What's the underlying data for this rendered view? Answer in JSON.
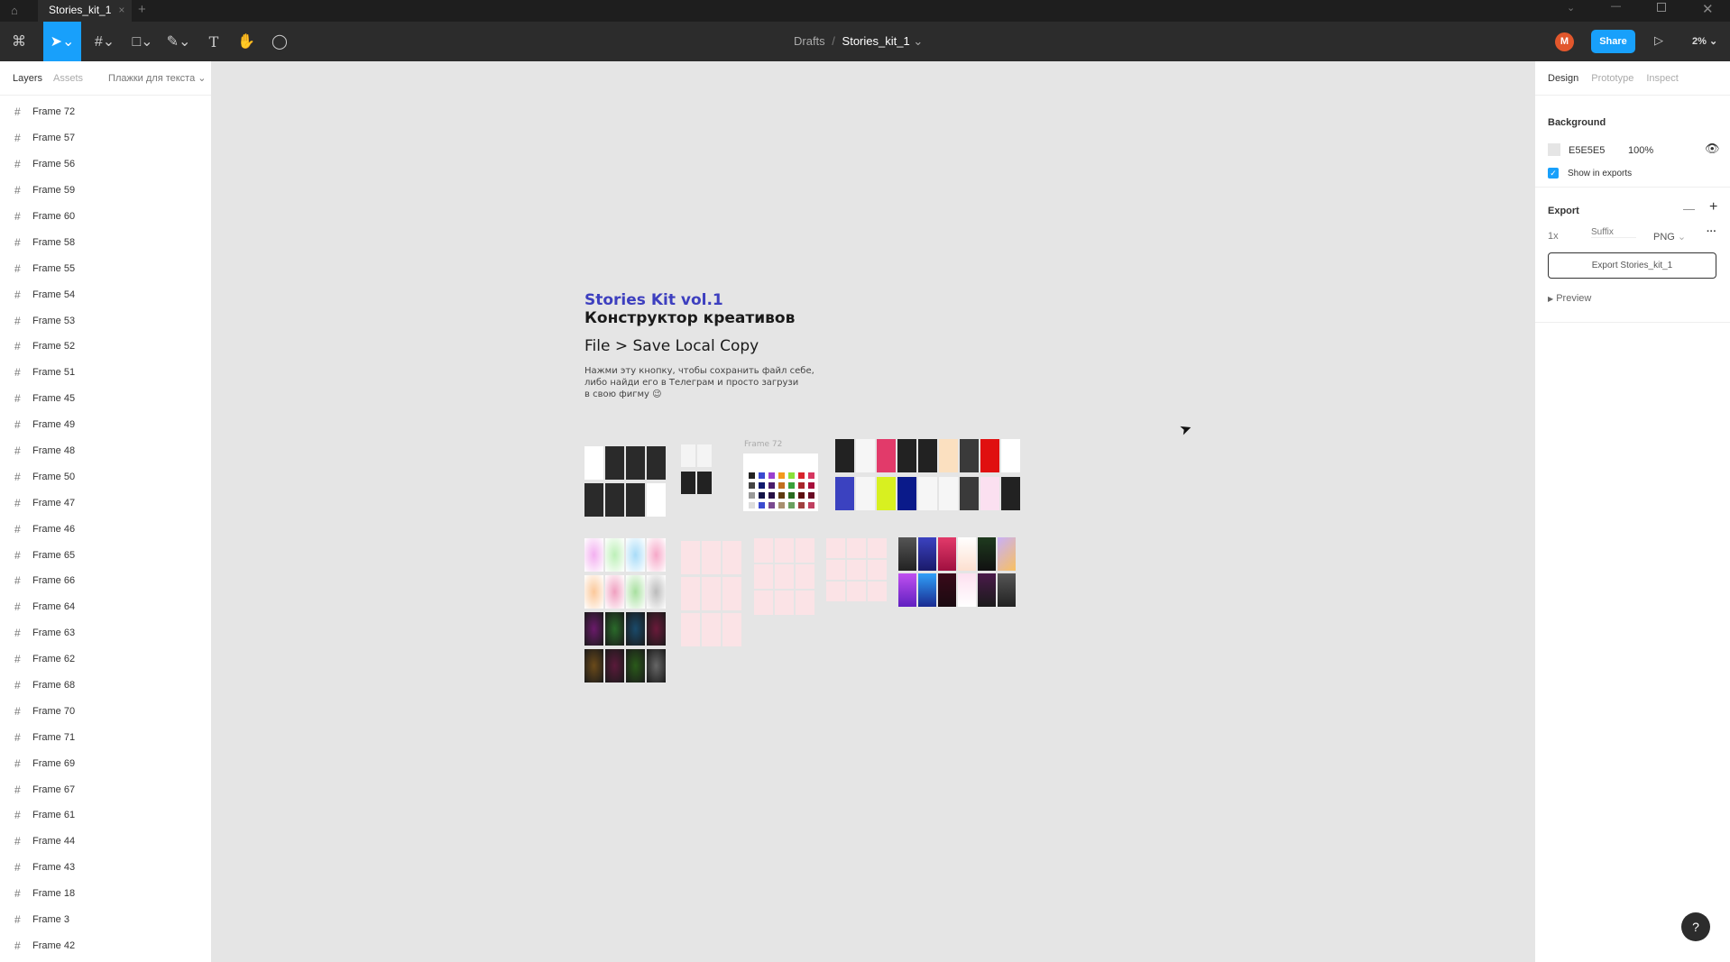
{
  "tabbar": {
    "tab_title": "Stories_kit_1",
    "close": "×",
    "add": "+"
  },
  "toolbar": {
    "breadcrumb_parent": "Drafts",
    "breadcrumb_sep": "/",
    "file_name": "Stories_kit_1",
    "avatar_initial": "M",
    "share_label": "Share",
    "zoom": "2%",
    "accent": "#18a0fb"
  },
  "left_panel": {
    "tabs": [
      "Layers",
      "Assets"
    ],
    "page_select": "Плажки для текста",
    "layers": [
      "Frame 72",
      "Frame 57",
      "Frame 56",
      "Frame 59",
      "Frame 60",
      "Frame 58",
      "Frame 55",
      "Frame 54",
      "Frame 53",
      "Frame 52",
      "Frame 51",
      "Frame 45",
      "Frame 49",
      "Frame 48",
      "Frame 50",
      "Frame 47",
      "Frame 46",
      "Frame 65",
      "Frame 66",
      "Frame 64",
      "Frame 63",
      "Frame 62",
      "Frame 68",
      "Frame 70",
      "Frame 71",
      "Frame 69",
      "Frame 67",
      "Frame 61",
      "Frame 44",
      "Frame 43",
      "Frame 18",
      "Frame 3",
      "Frame 42"
    ]
  },
  "right_panel": {
    "tabs": [
      "Design",
      "Prototype",
      "Inspect"
    ],
    "background": {
      "title": "Background",
      "color_hex": "E5E5E5",
      "opacity": "100%",
      "show_in_exports": "Show in exports",
      "checked": true
    },
    "export": {
      "title": "Export",
      "scale": "1x",
      "suffix_placeholder": "Suffix",
      "format": "PNG",
      "button": "Export Stories_kit_1",
      "preview": "Preview"
    }
  },
  "canvas": {
    "title": "Stories Kit vol.1",
    "subtitle": "Конструктор креативов",
    "instruction": "File > Save Local Copy",
    "description": [
      "Нажми эту кнопку, чтобы сохранить файл себе,",
      "либо найди его в Телеграм и просто загрузи",
      "в свою фигму 😉"
    ],
    "frame_label": "Frame 72",
    "title_color": "#3d3fbf"
  },
  "help": "?"
}
